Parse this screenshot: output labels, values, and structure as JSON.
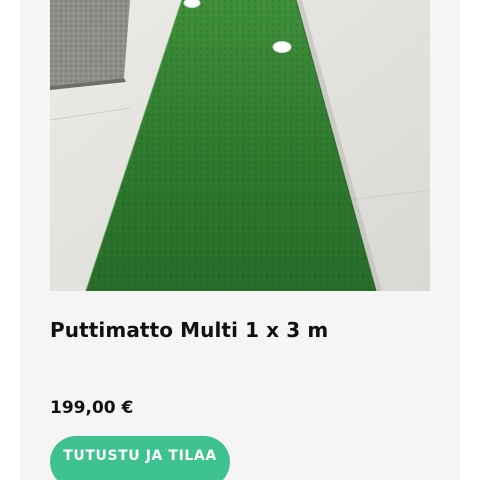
{
  "product": {
    "title": "Puttimatto Multi 1 x 3 m",
    "price": "199,00 €",
    "cta_label": "TUTUSTU JA TILAA",
    "image_icon": "putting-mat-photo"
  },
  "colors": {
    "card_background": "#f5f5f5",
    "cta_background": "#3ec28f",
    "cta_text": "#ffffff",
    "mat_green": "#2f7d32"
  }
}
